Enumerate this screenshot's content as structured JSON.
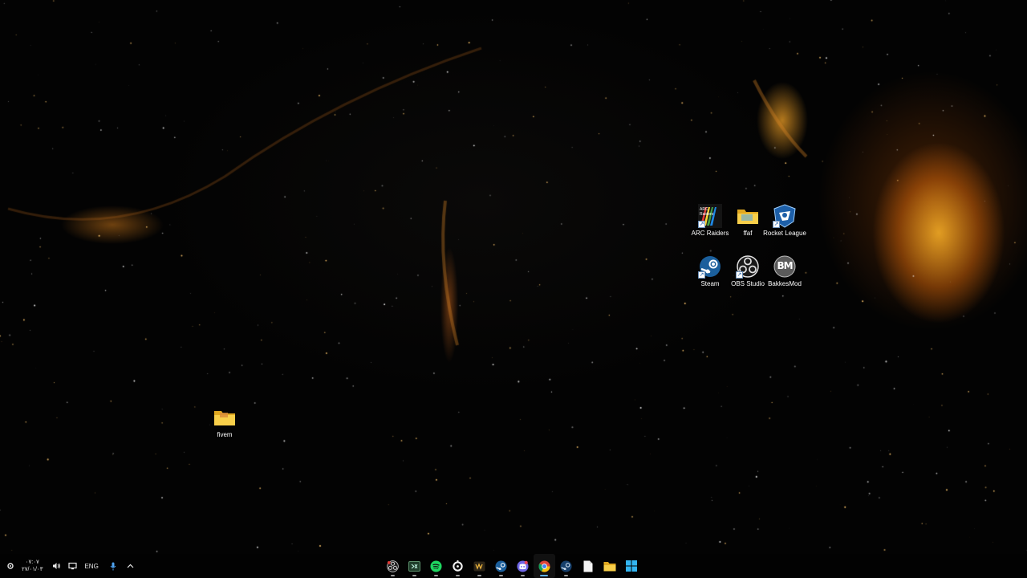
{
  "desktop": {
    "icons": [
      {
        "id": "arc-raiders",
        "label": "ARC Raiders",
        "icon": "arc-raiders-logo",
        "shortcut": true
      },
      {
        "id": "ffaf",
        "label": "ffaf",
        "icon": "folder-icon",
        "shortcut": false
      },
      {
        "id": "rocket-league",
        "label": "Rocket League",
        "icon": "rocket-league-logo",
        "shortcut": true
      },
      {
        "id": "steam",
        "label": "Steam",
        "icon": "steam-logo",
        "shortcut": true
      },
      {
        "id": "obs-studio",
        "label": "OBS Studio",
        "icon": "obs-logo",
        "shortcut": true
      },
      {
        "id": "bakkesmod",
        "label": "BakkesMod",
        "icon": "bakkesmod-logo",
        "shortcut": false
      },
      {
        "id": "fivem",
        "label": "fivem",
        "icon": "folder-icon",
        "shortcut": false
      }
    ],
    "arc_logo_text": "ARC Raiders",
    "bakkes_logo_text": "BM"
  },
  "taskbar": {
    "tray": {
      "clock_time": "۰۷:۰۷",
      "clock_date": "۲۷/۰۱/۰۳",
      "language": "ENG"
    },
    "apps": [
      {
        "name": "obs-studio",
        "running": true,
        "active": false
      },
      {
        "name": "terminal",
        "running": true,
        "active": false
      },
      {
        "name": "spotify",
        "running": true,
        "active": false
      },
      {
        "name": "app-ring",
        "running": true,
        "active": false
      },
      {
        "name": "game-app",
        "running": true,
        "active": false
      },
      {
        "name": "steam",
        "running": true,
        "active": false
      },
      {
        "name": "discord",
        "running": true,
        "active": false
      },
      {
        "name": "chrome",
        "running": true,
        "active": true
      },
      {
        "name": "steam-2",
        "running": true,
        "active": false
      },
      {
        "name": "file",
        "running": false,
        "active": false
      },
      {
        "name": "file-explorer",
        "running": false,
        "active": false
      },
      {
        "name": "start",
        "running": false,
        "active": false
      }
    ]
  },
  "colors": {
    "nebula_orange": "#f5a623",
    "folder_yellow": "#f4c542",
    "active_indicator": "#5fb2f2"
  }
}
